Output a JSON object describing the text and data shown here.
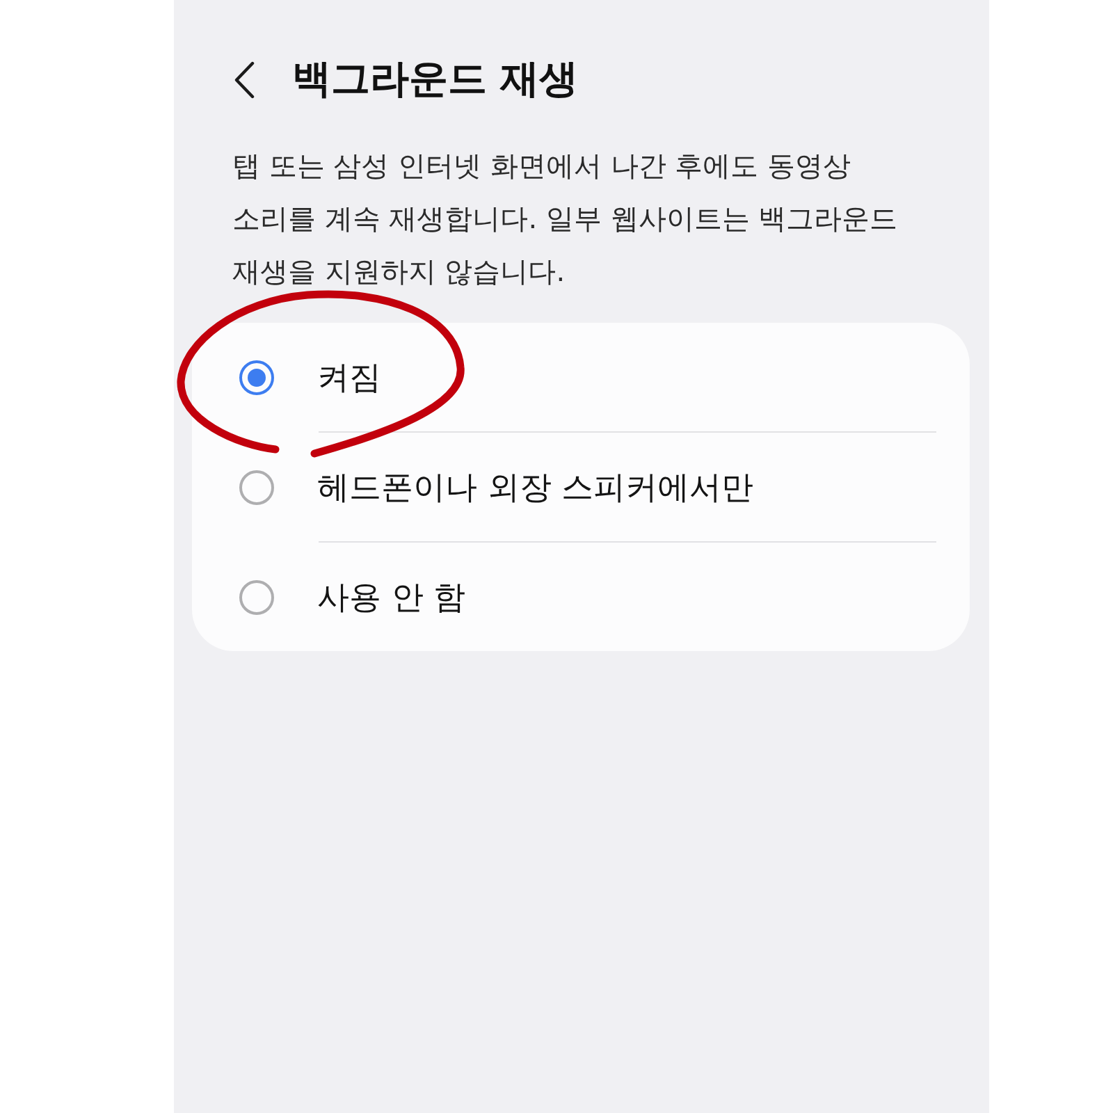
{
  "header": {
    "title": "백그라운드 재생"
  },
  "description": "탭 또는 삼성 인터넷 화면에서 나간 후에도 동영상 소리를 계속 재생합니다. 일부 웹사이트는 백그라운드 재생을 지원하지 않습니다.",
  "options": [
    {
      "label": "켜짐",
      "selected": true
    },
    {
      "label": "헤드폰이나 외장 스피커에서만",
      "selected": false
    },
    {
      "label": "사용 안 함",
      "selected": false
    }
  ]
}
